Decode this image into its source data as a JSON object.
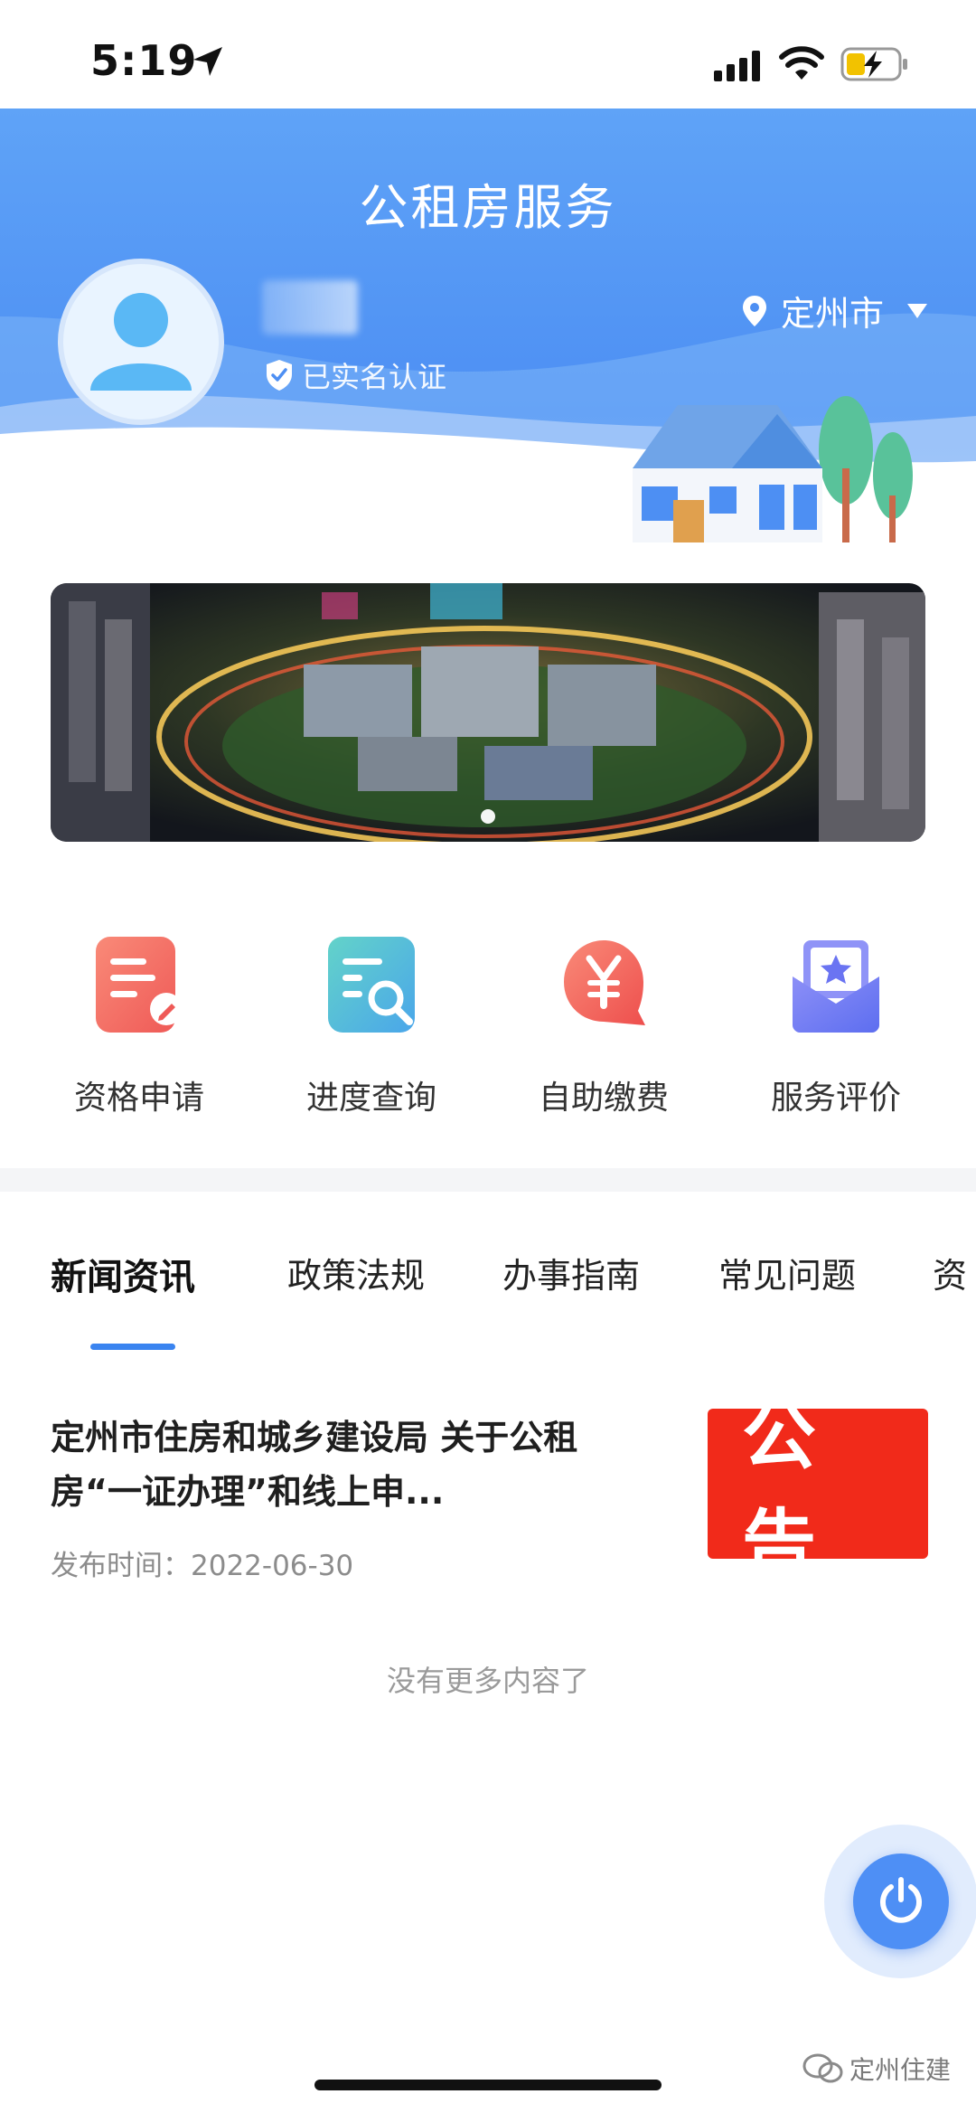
{
  "status_bar": {
    "time": "5:19"
  },
  "header": {
    "title": "公租房服务",
    "verified_label": "已实名认证",
    "city": "定州市"
  },
  "actions": [
    {
      "label": "资格申请",
      "icon": "application-form-icon",
      "color": "#f0665c"
    },
    {
      "label": "进度查询",
      "icon": "progress-search-icon",
      "color": "#4bb9e3"
    },
    {
      "label": "自助缴费",
      "icon": "yuan-payment-icon",
      "color": "#f0665c"
    },
    {
      "label": "服务评价",
      "icon": "service-rating-icon",
      "color": "#6f7ff2"
    }
  ],
  "tabs": [
    {
      "label": "新闻资讯",
      "active": true
    },
    {
      "label": "政策法规",
      "active": false
    },
    {
      "label": "办事指南",
      "active": false
    },
    {
      "label": "常见问题",
      "active": false
    },
    {
      "label": "资",
      "active": false
    }
  ],
  "news": [
    {
      "title": "定州市住房和城乡建设局 关于公租房“一证办理”和线上申...",
      "date": "发布时间：2022-06-30",
      "thumb_text": "公告"
    }
  ],
  "list_end_text": "没有更多内容了",
  "watermark": "定州住建",
  "colors": {
    "accent": "#3a84f0",
    "header_blue": "#5fa3f7",
    "notice_red": "#f12a1a"
  }
}
